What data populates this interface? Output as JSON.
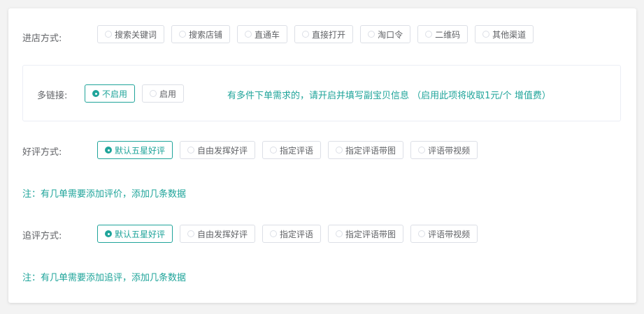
{
  "entry": {
    "label": "进店方式:",
    "options": [
      {
        "label": "搜索关键词",
        "selected": false
      },
      {
        "label": "搜索店铺",
        "selected": false
      },
      {
        "label": "直通车",
        "selected": false
      },
      {
        "label": "直接打开",
        "selected": false
      },
      {
        "label": "淘口令",
        "selected": false
      },
      {
        "label": "二维码",
        "selected": false
      },
      {
        "label": "其他渠道",
        "selected": false
      }
    ]
  },
  "multilink": {
    "label": "多链接:",
    "options": [
      {
        "label": "不启用",
        "selected": true
      },
      {
        "label": "启用",
        "selected": false
      }
    ],
    "hint": "有多件下单需求的，请开启并填写副宝贝信息 （启用此项将收取1元/个 增值费）"
  },
  "review": {
    "label": "好评方式:",
    "options": [
      {
        "label": "默认五星好评",
        "selected": true
      },
      {
        "label": "自由发挥好评",
        "selected": false
      },
      {
        "label": "指定评语",
        "selected": false
      },
      {
        "label": "指定评语带图",
        "selected": false
      },
      {
        "label": "评语带视频",
        "selected": false
      }
    ],
    "note": "注：有几单需要添加评价，添加几条数据"
  },
  "followup": {
    "label": "追评方式:",
    "options": [
      {
        "label": "默认五星好评",
        "selected": true
      },
      {
        "label": "自由发挥好评",
        "selected": false
      },
      {
        "label": "指定评语",
        "selected": false
      },
      {
        "label": "指定评语带图",
        "selected": false
      },
      {
        "label": "评语带视频",
        "selected": false
      }
    ],
    "note": "注：有几单需要添加追评，添加几条数据"
  },
  "colors": {
    "accent": "#1fa49a",
    "border": "#dcdfe6",
    "text": "#606266"
  }
}
